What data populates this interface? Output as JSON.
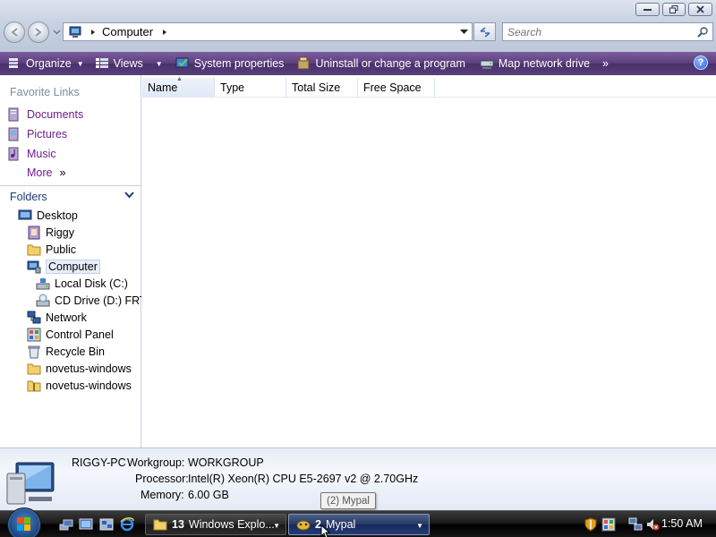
{
  "window": {
    "controls": [
      "minimize",
      "restore",
      "close"
    ]
  },
  "nav": {
    "back_label": "Back",
    "forward_label": "Forward"
  },
  "address": {
    "segment": "Computer",
    "icon": "computer-icon"
  },
  "search": {
    "placeholder": "Search"
  },
  "toolbar": {
    "items": [
      {
        "label": "Organize",
        "icon": "organize-icon",
        "dropdown": true
      },
      {
        "label": "Views",
        "icon": "views-icon",
        "dropdown": true
      },
      {
        "label": "System properties",
        "icon": "system-properties-icon"
      },
      {
        "label": "Uninstall or change a program",
        "icon": "uninstall-icon"
      },
      {
        "label": "Map network drive",
        "icon": "map-drive-icon"
      }
    ],
    "overflow": "»",
    "help": "?"
  },
  "favorites": {
    "title": "Favorite Links",
    "items": [
      {
        "label": "Documents",
        "icon": "documents-icon"
      },
      {
        "label": "Pictures",
        "icon": "pictures-icon"
      },
      {
        "label": "Music",
        "icon": "music-icon"
      },
      {
        "label": "More",
        "icon": "more-chevron-icon"
      }
    ],
    "more_suffix": "»"
  },
  "folders": {
    "title": "Folders",
    "tree": [
      {
        "label": "Desktop",
        "icon": "desktop-icon"
      },
      {
        "label": "Riggy",
        "icon": "user-folder-icon"
      },
      {
        "label": "Public",
        "icon": "folder-icon"
      },
      {
        "label": "Computer",
        "icon": "computer-icon",
        "selected": true
      },
      {
        "label": "Local Disk (C:)",
        "icon": "hard-disk-icon"
      },
      {
        "label": "CD Drive (D:) FRTI",
        "icon": "cd-drive-icon"
      },
      {
        "label": "Network",
        "icon": "network-icon"
      },
      {
        "label": "Control Panel",
        "icon": "control-panel-icon"
      },
      {
        "label": "Recycle Bin",
        "icon": "recycle-bin-icon"
      },
      {
        "label": "novetus-windows",
        "icon": "folder-icon"
      },
      {
        "label": "novetus-windows",
        "icon": "zip-folder-icon"
      }
    ]
  },
  "columns": [
    "Name",
    "Type",
    "Total Size",
    "Free Space"
  ],
  "details": {
    "computer_name": "RIGGY-PC",
    "workgroup_label": "Workgroup:",
    "workgroup": "WORKGROUP",
    "processor_label": "Processor:",
    "processor": "Intel(R) Xeon(R) CPU E5-2697 v2 @ 2.70GHz",
    "memory_label": "Memory:",
    "memory": "6.00 GB"
  },
  "taskbar": {
    "tasks": [
      {
        "count": "13",
        "label": "Windows Explo...",
        "icon": "folder-icon",
        "active": false
      },
      {
        "count": "2",
        "label": "Mypal",
        "icon": "mypal-icon",
        "active": true
      }
    ],
    "tooltip": "(2) Mypal",
    "clock": "1:50 AM"
  },
  "colors": {
    "toolbar": "#5a3f7c",
    "favorite_link": "#6f1e8f",
    "folders_title": "#1c3c78"
  }
}
